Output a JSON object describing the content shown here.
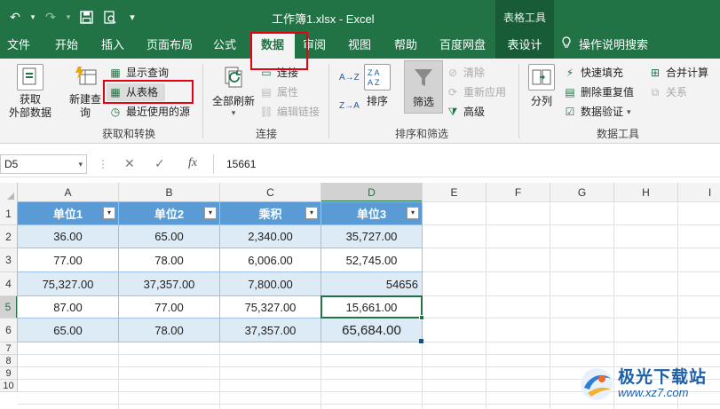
{
  "titlebar": {
    "doc_title": "工作簿1.xlsx  -  Excel",
    "context_title": "表格工具",
    "qat": {
      "undo": "↶",
      "undo_drop": "▾",
      "redo": "↷",
      "redo_drop": "▾",
      "save": "🖫",
      "preview": "🔍",
      "more": "≡"
    }
  },
  "tabs": [
    "文件",
    "开始",
    "插入",
    "页面布局",
    "公式",
    "数据",
    "审阅",
    "视图",
    "帮助",
    "百度网盘",
    "表设计"
  ],
  "tell_me": "操作说明搜索",
  "ribbon": {
    "get_data": "获取\n外部数据",
    "new_query": "新建查\n询",
    "show_queries": "显示查询",
    "from_table": "从表格",
    "recent_sources": "最近使用的源",
    "group_get_transform": "获取和转换",
    "refresh_all": "全部刷新",
    "connections": "连接",
    "properties": "属性",
    "edit_links": "编辑链接",
    "group_connections": "连接",
    "sort_az": "A→Z",
    "sort_za": "Z→A",
    "sort": "排序",
    "filter": "筛选",
    "clear": "清除",
    "reapply": "重新应用",
    "advanced": "高级",
    "group_sort_filter": "排序和筛选",
    "text_to_columns": "分列",
    "flash_fill": "快速填充",
    "remove_duplicates": "删除重复值",
    "data_validation": "数据验证",
    "consolidate": "合并计算",
    "relationships": "关系",
    "group_data_tools": "数据工具"
  },
  "formula_bar": {
    "name_box": "D5",
    "cancel": "✕",
    "enter": "✓",
    "fx": "fx",
    "value": "15661"
  },
  "columns": [
    "A",
    "B",
    "C",
    "D",
    "E",
    "F",
    "G",
    "H",
    "I"
  ],
  "rows": [
    "1",
    "2",
    "3",
    "4",
    "5",
    "6",
    "7",
    "8",
    "9",
    "10"
  ],
  "table": {
    "headers": [
      "单位1",
      "单位2",
      "乘积",
      "单位3"
    ],
    "rows": [
      [
        "36.00",
        "65.00",
        "2,340.00",
        "35,727.00"
      ],
      [
        "77.00",
        "78.00",
        "6,006.00",
        "52,745.00"
      ],
      [
        "75,327.00",
        "37,357.00",
        "7,800.00",
        "54656"
      ],
      [
        "87.00",
        "77.00",
        "75,327.00",
        "15,661.00"
      ],
      [
        "65.00",
        "78.00",
        "37,357.00",
        "65,684.00"
      ]
    ],
    "dropdown_glyph": "▾"
  },
  "watermark": {
    "name": "极光下载站",
    "url": "www.xz7.com"
  },
  "colors": {
    "excel_green": "#217346",
    "table_header": "#5b9bd5",
    "table_band": "#ddebf7",
    "annotation_red": "#e60012"
  }
}
